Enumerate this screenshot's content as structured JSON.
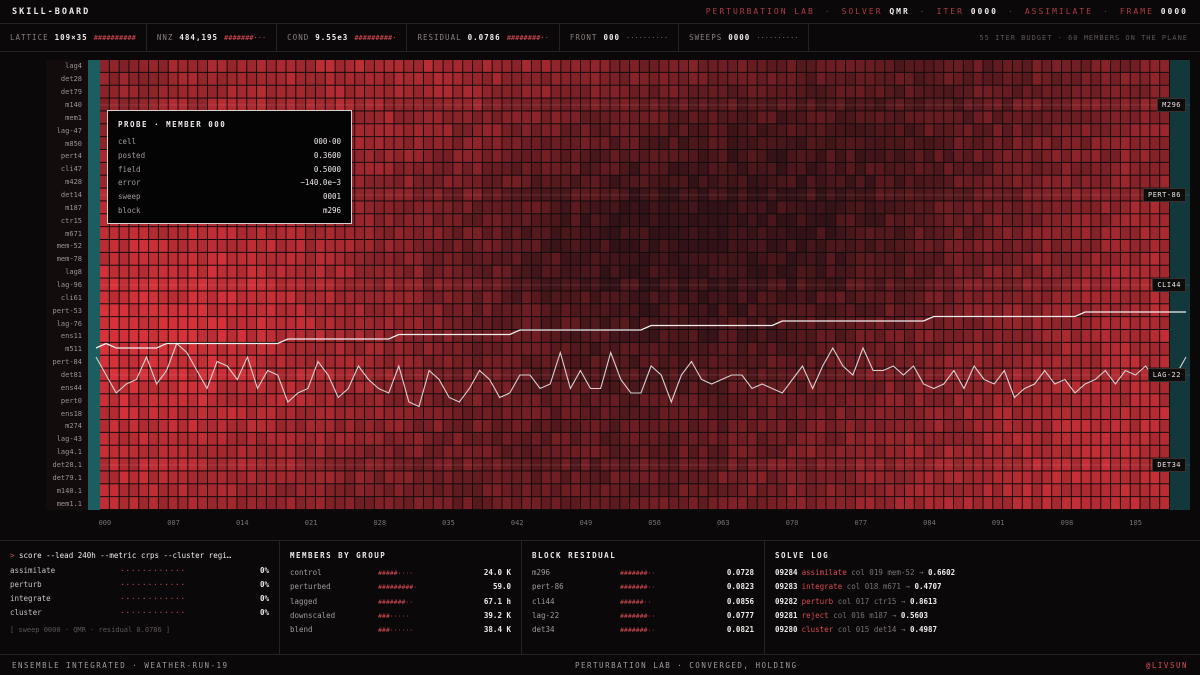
{
  "header": {
    "brand": "SKILL-BOARD",
    "lab": "PERTURBATION LAB",
    "solver_label": "SOLVER",
    "solver_value": "QMR",
    "iter_label": "ITER",
    "iter_value": "0000",
    "mode": "ASSIMILATE",
    "frame_label": "FRAME",
    "frame_value": "0000"
  },
  "metrics": [
    {
      "label": "LATTICE",
      "value": "109×35",
      "bar": "##########",
      "style": "red"
    },
    {
      "label": "NNZ",
      "value": "484,195",
      "bar": "#######···",
      "style": "red"
    },
    {
      "label": "COND",
      "value": "9.55e3",
      "bar": "#########·",
      "style": "red"
    },
    {
      "label": "RESIDUAL",
      "value": "0.0786",
      "bar": "########··",
      "style": "red"
    },
    {
      "label": "FRONT",
      "value": "000",
      "bar": "··········",
      "style": "dots"
    },
    {
      "label": "SWEEPS",
      "value": "0000",
      "bar": "··········",
      "style": "dots"
    }
  ],
  "budget": "55 ITER BUDGET · 60 MEMBERS ON THE PLANE",
  "row_labels": [
    "lag4",
    "det28",
    "det79",
    "m140",
    "mem1",
    "lag-47",
    "m850",
    "pert4",
    "cli47",
    "m428",
    "det14",
    "m187",
    "ctr15",
    "m671",
    "mem-52",
    "mem-78",
    "lag8",
    "lag-96",
    "cli61",
    "pert-53",
    "lag-76",
    "ens11",
    "m511",
    "pert-84",
    "det81",
    "ens44",
    "pert0",
    "ens18",
    "m274",
    "lag-43",
    "lag4.1",
    "det28.1",
    "det79.1",
    "m140.1",
    "mem1.1"
  ],
  "x_ticks": [
    "000",
    "007",
    "014",
    "021",
    "028",
    "035",
    "042",
    "049",
    "056",
    "063",
    "070",
    "077",
    "084",
    "091",
    "098",
    "105"
  ],
  "block_tags": [
    {
      "label": "M296",
      "row": 3
    },
    {
      "label": "PERT-86",
      "row": 10
    },
    {
      "label": "CLI44",
      "row": 17
    },
    {
      "label": "LAG-22",
      "row": 24
    },
    {
      "label": "DET34",
      "row": 31
    }
  ],
  "probe": {
    "title": "PROBE · MEMBER 000",
    "rows": [
      {
        "k": "cell",
        "v": "000·00"
      },
      {
        "k": "posted",
        "v": "0.3600"
      },
      {
        "k": "field",
        "v": "0.5000"
      },
      {
        "k": "error",
        "v": "−140.0e−3"
      },
      {
        "k": "sweep",
        "v": "0001"
      },
      {
        "k": "block",
        "v": "m296"
      }
    ]
  },
  "cli": {
    "prompt": ">",
    "command": "score --lead 240h --metric crps --cluster regi…",
    "rows": [
      {
        "k": "assimilate",
        "d": "············",
        "p": "0%"
      },
      {
        "k": "perturb",
        "d": "············",
        "p": "0%"
      },
      {
        "k": "integrate",
        "d": "············",
        "p": "0%"
      },
      {
        "k": "cluster",
        "d": "············",
        "p": "0%"
      }
    ],
    "status": "[ sweep 0000 · QMR · residual 0.0786 ]"
  },
  "members": {
    "title": "MEMBERS BY GROUP",
    "rows": [
      {
        "k": "control",
        "b": "#####····",
        "v": "24.0 K"
      },
      {
        "k": "perturbed",
        "b": "#########·",
        "v": "59.0"
      },
      {
        "k": "lagged",
        "b": "#######··",
        "v": "67.1 h"
      },
      {
        "k": "downscaled",
        "b": "###·····",
        "v": "39.2 K"
      },
      {
        "k": "blend",
        "b": "###······",
        "v": "38.4 K"
      }
    ]
  },
  "residual": {
    "title": "BLOCK RESIDUAL",
    "rows": [
      {
        "k": "m296",
        "b": "#######··",
        "v": "0.0728"
      },
      {
        "k": "pert-86",
        "b": "#######··",
        "v": "0.0823"
      },
      {
        "k": "cli44",
        "b": "######··",
        "v": "0.0856"
      },
      {
        "k": "lag-22",
        "b": "#######··",
        "v": "0.0777"
      },
      {
        "k": "det34",
        "b": "#######··",
        "v": "0.0821"
      }
    ]
  },
  "solvelog": {
    "title": "SOLVE LOG",
    "rows": [
      {
        "id": "09284",
        "act": "assimilate",
        "txt": "col 019 mem-52 →",
        "res": "0.6602"
      },
      {
        "id": "09283",
        "act": "integrate",
        "txt": "col 018 m671 →",
        "res": "0.4707"
      },
      {
        "id": "09282",
        "act": "perturb",
        "txt": "col 017 ctr15 →",
        "res": "0.8613"
      },
      {
        "id": "09281",
        "act": "reject",
        "txt": "col 016 m187 →",
        "res": "0.5603"
      },
      {
        "id": "09280",
        "act": "cluster",
        "txt": "col 015 det14 →",
        "res": "0.4987"
      }
    ]
  },
  "footer": {
    "left": "ENSEMBLE INTEGRATED · WEATHER-RUN-19",
    "mid": "PERTURBATION LAB · CONVERGED, HOLDING",
    "right": "@LIVSUN"
  },
  "colors": {
    "accent": "#d94b55",
    "teal": "#1f6b6b",
    "bg": "#0a0808"
  },
  "chart_data": {
    "type": "heatmap",
    "columns": 109,
    "rows": 35,
    "x_tick_labels": [
      "000",
      "007",
      "014",
      "021",
      "028",
      "035",
      "042",
      "049",
      "056",
      "063",
      "070",
      "077",
      "084",
      "091",
      "098",
      "105"
    ],
    "series": [
      {
        "values": [
          0.34,
          0.3,
          0.26,
          0.28,
          0.29,
          0.34,
          0.28,
          0.31,
          0.37,
          0.35,
          0.31,
          0.27,
          0.33,
          0.32,
          0.29,
          0.34,
          0.27,
          0.31,
          0.3,
          0.24,
          0.26,
          0.27,
          0.33,
          0.3,
          0.25,
          0.27,
          0.32,
          0.29,
          0.27,
          0.26,
          0.32,
          0.24,
          0.23,
          0.31,
          0.29,
          0.25,
          0.24,
          0.27,
          0.31,
          0.29,
          0.25,
          0.26,
          0.3,
          0.3,
          0.27,
          0.28,
          0.35,
          0.27,
          0.31,
          0.27,
          0.27,
          0.35,
          0.29,
          0.26,
          0.26,
          0.32,
          0.3,
          0.24,
          0.3,
          0.33,
          0.29,
          0.28,
          0.29,
          0.3,
          0.3,
          0.27,
          0.28,
          0.27,
          0.26,
          0.29,
          0.32,
          0.27,
          0.32,
          0.36,
          0.32,
          0.3,
          0.36,
          0.31,
          0.31,
          0.32,
          0.3,
          0.32,
          0.28,
          0.27,
          0.28,
          0.31,
          0.27,
          0.32,
          0.29,
          0.28,
          0.31,
          0.25,
          0.27,
          0.28,
          0.31,
          0.28,
          0.29,
          0.26,
          0.28,
          0.29,
          0.31,
          0.28,
          0.31,
          0.3,
          0.32,
          0.29,
          0.31,
          0.3,
          0.34
        ]
      },
      {
        "values": [
          0.36,
          0.37,
          0.36,
          0.36,
          0.36,
          0.36,
          0.36,
          0.37,
          0.37,
          0.37,
          0.37,
          0.37,
          0.37,
          0.37,
          0.37,
          0.37,
          0.37,
          0.37,
          0.37,
          0.38,
          0.38,
          0.38,
          0.38,
          0.38,
          0.38,
          0.38,
          0.38,
          0.38,
          0.38,
          0.38,
          0.39,
          0.39,
          0.39,
          0.39,
          0.39,
          0.39,
          0.39,
          0.39,
          0.39,
          0.39,
          0.39,
          0.39,
          0.4,
          0.4,
          0.4,
          0.4,
          0.4,
          0.4,
          0.4,
          0.4,
          0.4,
          0.4,
          0.4,
          0.4,
          0.4,
          0.41,
          0.41,
          0.41,
          0.41,
          0.41,
          0.41,
          0.41,
          0.41,
          0.41,
          0.41,
          0.41,
          0.41,
          0.41,
          0.42,
          0.42,
          0.42,
          0.42,
          0.42,
          0.42,
          0.42,
          0.42,
          0.42,
          0.42,
          0.42,
          0.42,
          0.42,
          0.42,
          0.42,
          0.43,
          0.43,
          0.43,
          0.43,
          0.43,
          0.43,
          0.43,
          0.43,
          0.43,
          0.43,
          0.43,
          0.43,
          0.43,
          0.43,
          0.43,
          0.44,
          0.44,
          0.44,
          0.44,
          0.44,
          0.44,
          0.44,
          0.44,
          0.44,
          0.44,
          0.44
        ]
      }
    ]
  }
}
